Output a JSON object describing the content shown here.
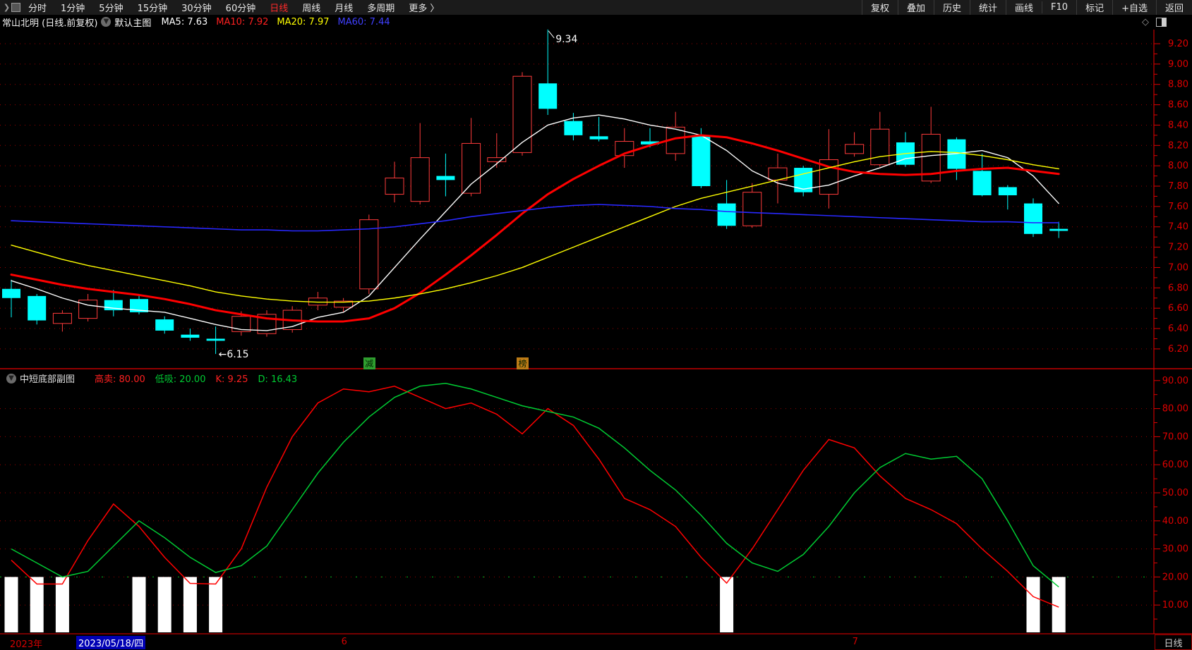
{
  "toolbar": {
    "periods": [
      {
        "label": "分时"
      },
      {
        "label": "1分钟"
      },
      {
        "label": "5分钟"
      },
      {
        "label": "15分钟"
      },
      {
        "label": "30分钟"
      },
      {
        "label": "60分钟"
      },
      {
        "label": "日线"
      },
      {
        "label": "周线"
      },
      {
        "label": "月线"
      },
      {
        "label": "多周期"
      },
      {
        "label": "更多 〉"
      }
    ],
    "active_period": "日线",
    "right_actions": [
      "复权",
      "叠加",
      "历史",
      "统计",
      "画线",
      "F10",
      "标记",
      "+自选",
      "返回"
    ]
  },
  "info_bar": {
    "stock_name": "常山北明 (日线.前复权)",
    "chart_label": "默认主图",
    "ma_labels": [
      {
        "label": "MA5: 7.63",
        "color": "#ffffff"
      },
      {
        "label": "MA10: 7.92",
        "color": "#ff2020"
      },
      {
        "label": "MA20: 7.97",
        "color": "#ffff00"
      },
      {
        "label": "MA60: 7.44",
        "color": "#4040ff"
      }
    ]
  },
  "sub_chart": {
    "title": "中短底部副图",
    "params": [
      {
        "label": "高卖: 80.00",
        "color": "#ff2020"
      },
      {
        "label": "低吸: 20.00",
        "color": "#00cc33"
      },
      {
        "label": "K: 9.25",
        "color": "#ff2020"
      },
      {
        "label": "D: 16.43",
        "color": "#00cc33"
      }
    ]
  },
  "signal_flags": [
    {
      "text": "减",
      "index": 14,
      "bg": "#2f9e2f"
    },
    {
      "text": "榜",
      "index": 20,
      "bg": "#bc7b16"
    }
  ],
  "bottom_bar": {
    "year": "2023年",
    "selected_date": "2023/05/18/四",
    "month_markers": [
      {
        "label": "6",
        "index": 13
      },
      {
        "label": "7",
        "index": 33
      }
    ],
    "period_label": "日线"
  },
  "chart_data": [
    {
      "type": "candlestick",
      "title": "常山北明 日线 前复权",
      "up_color": "#ff3b3b",
      "down_color": "#00ffff",
      "axis_color": "#e00000",
      "grid_color": "#9b0000",
      "y_axis": {
        "max": 9.2,
        "min": 6.2,
        "step": 0.2,
        "labels": [
          "9.20",
          "9.00",
          "8.80",
          "8.60",
          "8.40",
          "8.20",
          "8.00",
          "7.80",
          "7.60",
          "7.40",
          "7.20",
          "7.00",
          "6.80",
          "6.60",
          "6.40",
          "6.20"
        ]
      },
      "annotations": {
        "high": {
          "text": "9.34",
          "index": 21
        },
        "low": {
          "text": "←6.15",
          "index": 8
        }
      },
      "candles": [
        [
          6.79,
          6.88,
          6.51,
          6.7
        ],
        [
          6.72,
          6.74,
          6.44,
          6.48
        ],
        [
          6.45,
          6.58,
          6.37,
          6.55
        ],
        [
          6.5,
          6.74,
          6.47,
          6.68
        ],
        [
          6.68,
          6.78,
          6.52,
          6.58
        ],
        [
          6.69,
          6.73,
          6.54,
          6.56
        ],
        [
          6.49,
          6.52,
          6.35,
          6.38
        ],
        [
          6.34,
          6.4,
          6.28,
          6.31
        ],
        [
          6.3,
          6.42,
          6.15,
          6.28
        ],
        [
          6.37,
          6.57,
          6.33,
          6.52
        ],
        [
          6.35,
          6.58,
          6.32,
          6.54
        ],
        [
          6.39,
          6.62,
          6.36,
          6.58
        ],
        [
          6.63,
          6.76,
          6.58,
          6.7
        ],
        [
          6.61,
          6.7,
          6.56,
          6.67
        ],
        [
          6.79,
          7.52,
          6.74,
          7.47
        ],
        [
          7.72,
          8.04,
          7.64,
          7.88
        ],
        [
          7.65,
          8.42,
          7.62,
          8.08
        ],
        [
          7.9,
          8.12,
          7.7,
          7.86
        ],
        [
          7.73,
          8.47,
          7.7,
          8.22
        ],
        [
          8.04,
          8.32,
          7.98,
          8.08
        ],
        [
          8.13,
          8.92,
          8.1,
          8.88
        ],
        [
          8.81,
          9.34,
          8.5,
          8.56
        ],
        [
          8.44,
          8.52,
          8.25,
          8.3
        ],
        [
          8.29,
          8.48,
          8.24,
          8.26
        ],
        [
          8.1,
          8.37,
          7.98,
          8.24
        ],
        [
          8.24,
          8.37,
          8.18,
          8.21
        ],
        [
          8.12,
          8.53,
          8.05,
          8.38
        ],
        [
          8.3,
          8.37,
          7.78,
          7.8
        ],
        [
          7.63,
          7.86,
          7.38,
          7.41
        ],
        [
          7.41,
          7.83,
          7.39,
          7.74
        ],
        [
          7.86,
          8.12,
          7.63,
          7.98
        ],
        [
          7.98,
          8.0,
          7.7,
          7.74
        ],
        [
          7.72,
          8.36,
          7.58,
          8.06
        ],
        [
          8.12,
          8.33,
          8.09,
          8.21
        ],
        [
          8.01,
          8.53,
          7.99,
          8.36
        ],
        [
          8.23,
          8.33,
          7.99,
          8.01
        ],
        [
          7.85,
          8.58,
          7.83,
          8.31
        ],
        [
          8.26,
          8.28,
          7.86,
          7.97
        ],
        [
          7.95,
          8.12,
          7.7,
          7.71
        ],
        [
          7.79,
          7.81,
          7.57,
          7.71
        ],
        [
          7.63,
          7.68,
          7.3,
          7.33
        ],
        [
          7.38,
          7.45,
          7.29,
          7.36
        ]
      ],
      "ma_series": [
        {
          "name": "MA5",
          "color": "#ffffff",
          "width": 1.4,
          "values": [
            6.87,
            6.79,
            6.7,
            6.63,
            6.6,
            6.58,
            6.56,
            6.5,
            6.44,
            6.39,
            6.38,
            6.42,
            6.51,
            6.56,
            6.72,
            7.0,
            7.28,
            7.55,
            7.82,
            8.02,
            8.23,
            8.4,
            8.47,
            8.5,
            8.46,
            8.4,
            8.36,
            8.3,
            8.15,
            7.95,
            7.83,
            7.77,
            7.81,
            7.9,
            7.98,
            8.07,
            8.1,
            8.12,
            8.15,
            8.08,
            7.9,
            7.63
          ]
        },
        {
          "name": "MA10",
          "color": "#ff0000",
          "width": 3,
          "values": [
            6.93,
            6.88,
            6.83,
            6.79,
            6.76,
            6.73,
            6.69,
            6.64,
            6.58,
            6.54,
            6.5,
            6.48,
            6.47,
            6.47,
            6.5,
            6.6,
            6.75,
            6.93,
            7.12,
            7.32,
            7.53,
            7.72,
            7.87,
            8.0,
            8.12,
            8.2,
            8.27,
            8.3,
            8.28,
            8.22,
            8.15,
            8.07,
            7.99,
            7.94,
            7.92,
            7.91,
            7.92,
            7.95,
            7.97,
            7.98,
            7.95,
            7.92
          ]
        },
        {
          "name": "MA20",
          "color": "#ffff00",
          "width": 1.4,
          "values": [
            7.22,
            7.15,
            7.08,
            7.02,
            6.97,
            6.92,
            6.87,
            6.82,
            6.76,
            6.72,
            6.69,
            6.67,
            6.66,
            6.66,
            6.67,
            6.7,
            6.74,
            6.79,
            6.85,
            6.92,
            7.0,
            7.1,
            7.2,
            7.3,
            7.4,
            7.5,
            7.6,
            7.68,
            7.74,
            7.8,
            7.86,
            7.92,
            7.98,
            8.04,
            8.09,
            8.12,
            8.14,
            8.13,
            8.1,
            8.06,
            8.01,
            7.97
          ]
        },
        {
          "name": "MA60",
          "color": "#2828ff",
          "width": 1.6,
          "values": [
            7.46,
            7.45,
            7.44,
            7.43,
            7.42,
            7.41,
            7.4,
            7.39,
            7.38,
            7.37,
            7.37,
            7.36,
            7.36,
            7.37,
            7.38,
            7.4,
            7.43,
            7.46,
            7.5,
            7.53,
            7.56,
            7.59,
            7.61,
            7.62,
            7.61,
            7.6,
            7.58,
            7.57,
            7.55,
            7.54,
            7.53,
            7.52,
            7.51,
            7.5,
            7.49,
            7.48,
            7.47,
            7.46,
            7.45,
            7.45,
            7.44,
            7.44
          ]
        }
      ]
    },
    {
      "type": "line",
      "title": "中短底部副图",
      "y_axis": {
        "max": 90,
        "min": 0,
        "step": 10,
        "labels": [
          "90.00",
          "80.00",
          "70.00",
          "60.00",
          "50.00",
          "40.00",
          "30.00",
          "20.00",
          "10.00"
        ]
      },
      "levels": {
        "sell": 80.0,
        "buy": 20.0
      },
      "series": [
        {
          "name": "K",
          "color": "#ff0000",
          "width": 1.5,
          "values": [
            26,
            17.5,
            17.5,
            33,
            46,
            38,
            27,
            17.7,
            17.5,
            30,
            52,
            70,
            82,
            87,
            86,
            88,
            84,
            80,
            82,
            78,
            71,
            80,
            74,
            62,
            48,
            44,
            38,
            27,
            17.8,
            30,
            44,
            58,
            69,
            66,
            56,
            48,
            44,
            39,
            30,
            22,
            13,
            9.25
          ]
        },
        {
          "name": "D",
          "color": "#00cc33",
          "width": 1.5,
          "values": [
            30,
            25,
            20,
            22,
            31,
            40,
            34,
            27,
            21.6,
            24,
            31,
            44,
            57,
            68,
            77,
            84,
            88,
            89,
            87,
            84,
            81,
            79,
            77,
            73,
            66,
            58,
            51,
            42,
            32,
            25,
            22,
            28,
            38,
            50,
            59,
            64,
            62,
            63,
            55,
            40,
            24,
            16.43
          ]
        }
      ],
      "signal_bars": {
        "indices": [
          0,
          1,
          2,
          5,
          6,
          7,
          8,
          28,
          40,
          41
        ],
        "top_value": 20,
        "color": "#ffffff"
      }
    }
  ]
}
